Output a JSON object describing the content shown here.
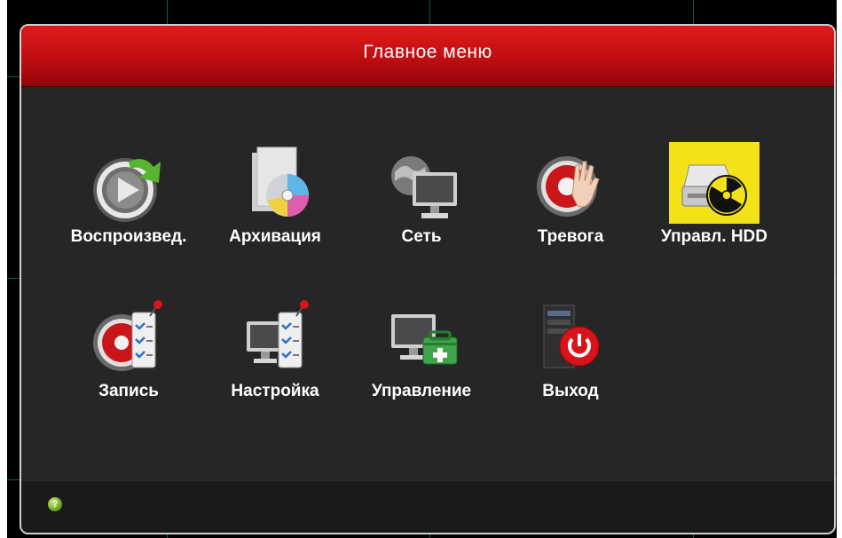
{
  "window": {
    "title": "Главное меню"
  },
  "menu_items": [
    {
      "label": "Воспроизвед.",
      "icon": "playback-icon"
    },
    {
      "label": "Архивация",
      "icon": "backup-disc-icon"
    },
    {
      "label": "Сеть",
      "icon": "network-icon"
    },
    {
      "label": "Тревога",
      "icon": "alarm-hand-icon"
    },
    {
      "label": "Управл. HDD",
      "icon": "hdd-radiation-icon",
      "selected": true
    },
    {
      "label": "Запись",
      "icon": "record-checklist-icon"
    },
    {
      "label": "Настройка",
      "icon": "settings-checklist-icon"
    },
    {
      "label": "Управление",
      "icon": "management-toolbox-icon"
    },
    {
      "label": "Выход",
      "icon": "exit-power-icon"
    }
  ],
  "footer": {
    "help_icon": "help-icon",
    "help_glyph": "?"
  },
  "colors": {
    "header": "#c30f12",
    "background": "#262626",
    "selected": "#f4e218",
    "text": "#ffffff"
  }
}
